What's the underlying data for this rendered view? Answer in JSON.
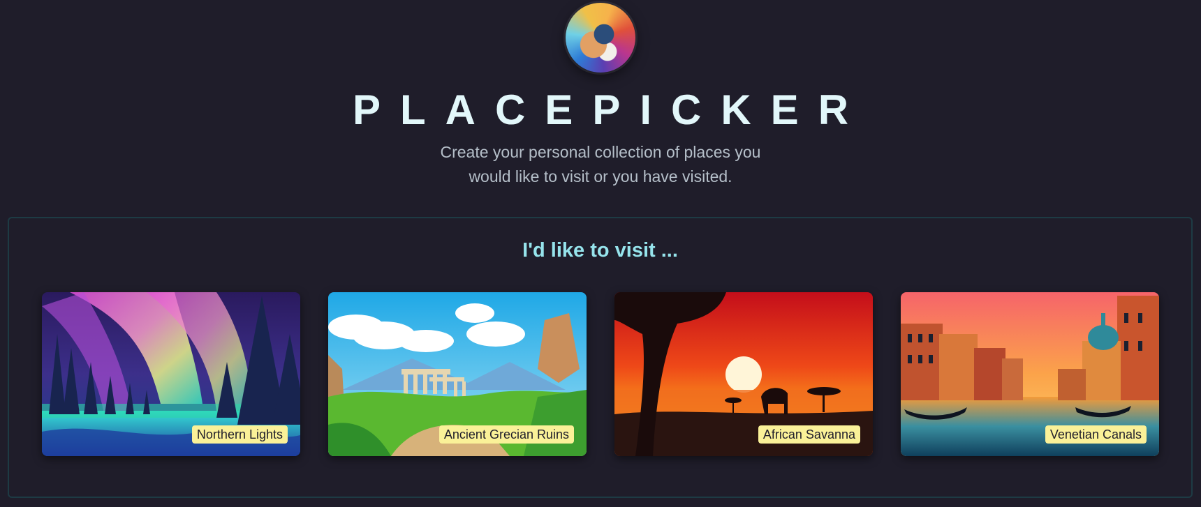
{
  "header": {
    "logo_icon": "globe-logo-icon",
    "title": "PLACEPICKER",
    "subtitle_line1": "Create your personal collection of places you",
    "subtitle_line2": "would like to visit or you have visited."
  },
  "section": {
    "title": "I'd like to visit ...",
    "places": [
      {
        "label": "Northern Lights"
      },
      {
        "label": "Ancient Grecian Ruins"
      },
      {
        "label": "African Savanna"
      },
      {
        "label": "Venetian Canals"
      }
    ]
  },
  "colors": {
    "background": "#1f1d2a",
    "title": "#e2f7fa",
    "section_title": "#96e4ec",
    "label_bg": "#faf198"
  }
}
